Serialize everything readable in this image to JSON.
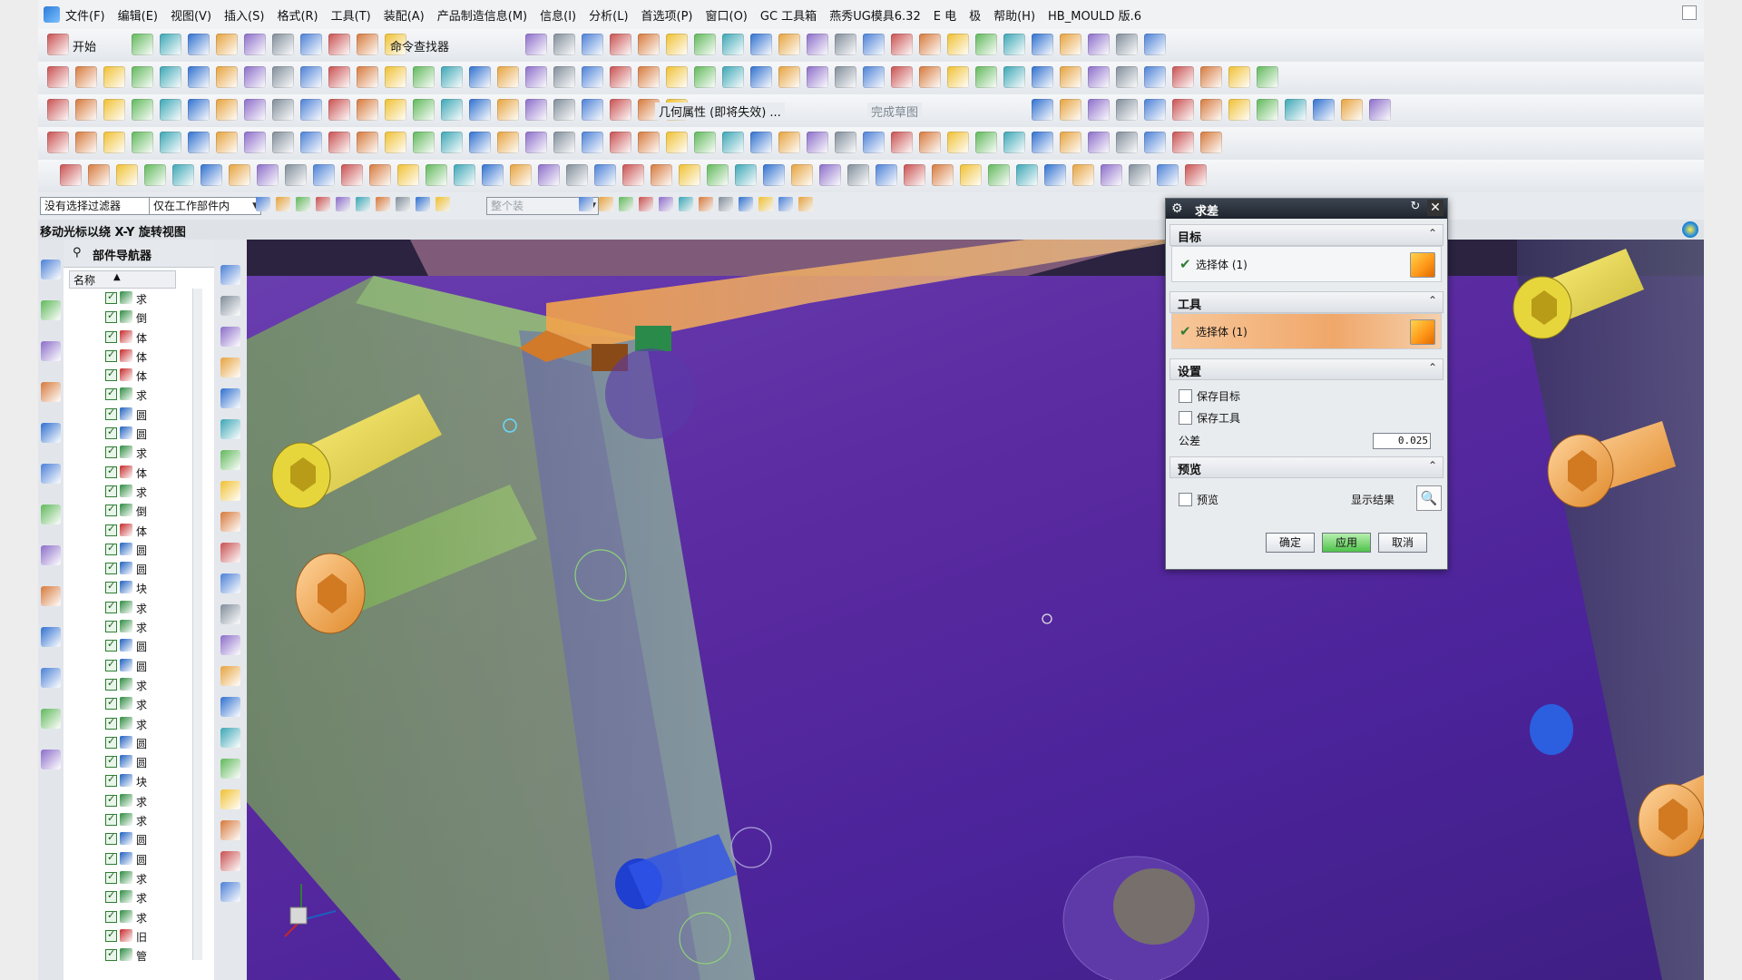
{
  "menubar": {
    "items": [
      "文件(F)",
      "编辑(E)",
      "视图(V)",
      "插入(S)",
      "格式(R)",
      "工具(T)",
      "装配(A)",
      "产品制造信息(M)",
      "信息(I)",
      "分析(L)",
      "首选项(P)",
      "窗口(O)",
      "GC 工具箱",
      "燕秀UG模具6.32",
      "E 电",
      "极",
      "帮助(H)",
      "HB_MOULD 版.6"
    ]
  },
  "toolbar": {
    "start_label": "开始",
    "command_finder_label": "命令查找器",
    "geometry_label": "几何属性 (即将失效) ...",
    "finish_sketch_label": "完成草图"
  },
  "filter": {
    "selection_filter": "没有选择过滤器",
    "scope": "仅在工作部件内",
    "entire_assembly": "整个装"
  },
  "cue": {
    "text": "移动光标以绕 X-Y 旋转视图"
  },
  "navigator": {
    "title": "部件导航器",
    "column_name": "名称",
    "rows": [
      {
        "icon": "求",
        "color": "#2b8a3e"
      },
      {
        "icon": "倒",
        "color": "#2b8a3e"
      },
      {
        "icon": "体",
        "color": "#c62828"
      },
      {
        "icon": "体",
        "color": "#c62828"
      },
      {
        "icon": "体",
        "color": "#c62828"
      },
      {
        "icon": "求",
        "color": "#2b8a3e"
      },
      {
        "icon": "圆",
        "color": "#1e5fbf"
      },
      {
        "icon": "圆",
        "color": "#1e5fbf"
      },
      {
        "icon": "求",
        "color": "#2b8a3e"
      },
      {
        "icon": "体",
        "color": "#c62828"
      },
      {
        "icon": "求",
        "color": "#2b8a3e"
      },
      {
        "icon": "倒",
        "color": "#2b8a3e"
      },
      {
        "icon": "体",
        "color": "#c62828"
      },
      {
        "icon": "圆",
        "color": "#1e5fbf"
      },
      {
        "icon": "圆",
        "color": "#1e5fbf"
      },
      {
        "icon": "块",
        "color": "#1e5fbf"
      },
      {
        "icon": "求",
        "color": "#2b8a3e"
      },
      {
        "icon": "求",
        "color": "#2b8a3e"
      },
      {
        "icon": "圆",
        "color": "#1e5fbf"
      },
      {
        "icon": "圆",
        "color": "#1e5fbf"
      },
      {
        "icon": "求",
        "color": "#2b8a3e"
      },
      {
        "icon": "求",
        "color": "#2b8a3e"
      },
      {
        "icon": "求",
        "color": "#2b8a3e"
      },
      {
        "icon": "圆",
        "color": "#1e5fbf"
      },
      {
        "icon": "圆",
        "color": "#1e5fbf"
      },
      {
        "icon": "块",
        "color": "#1e5fbf"
      },
      {
        "icon": "求",
        "color": "#2b8a3e"
      },
      {
        "icon": "求",
        "color": "#2b8a3e"
      },
      {
        "icon": "圆",
        "color": "#1e5fbf"
      },
      {
        "icon": "圆",
        "color": "#1e5fbf"
      },
      {
        "icon": "求",
        "color": "#2b8a3e"
      },
      {
        "icon": "求",
        "color": "#2b8a3e"
      },
      {
        "icon": "求",
        "color": "#2b8a3e"
      },
      {
        "icon": "旧",
        "color": "#c62828"
      },
      {
        "icon": "管",
        "color": "#2b8a3e"
      }
    ]
  },
  "dialog": {
    "title": "求差",
    "target_section": "目标",
    "target_select": "选择体 (1)",
    "tool_section": "工具",
    "tool_select": "选择体 (1)",
    "settings_section": "设置",
    "keep_target": "保存目标",
    "keep_tool": "保存工具",
    "tolerance_label": "公差",
    "tolerance_value": "0.025",
    "preview_section": "预览",
    "preview_label": "预览",
    "show_result": "显示结果",
    "ok": "确定",
    "apply": "应用",
    "cancel": "取消"
  }
}
